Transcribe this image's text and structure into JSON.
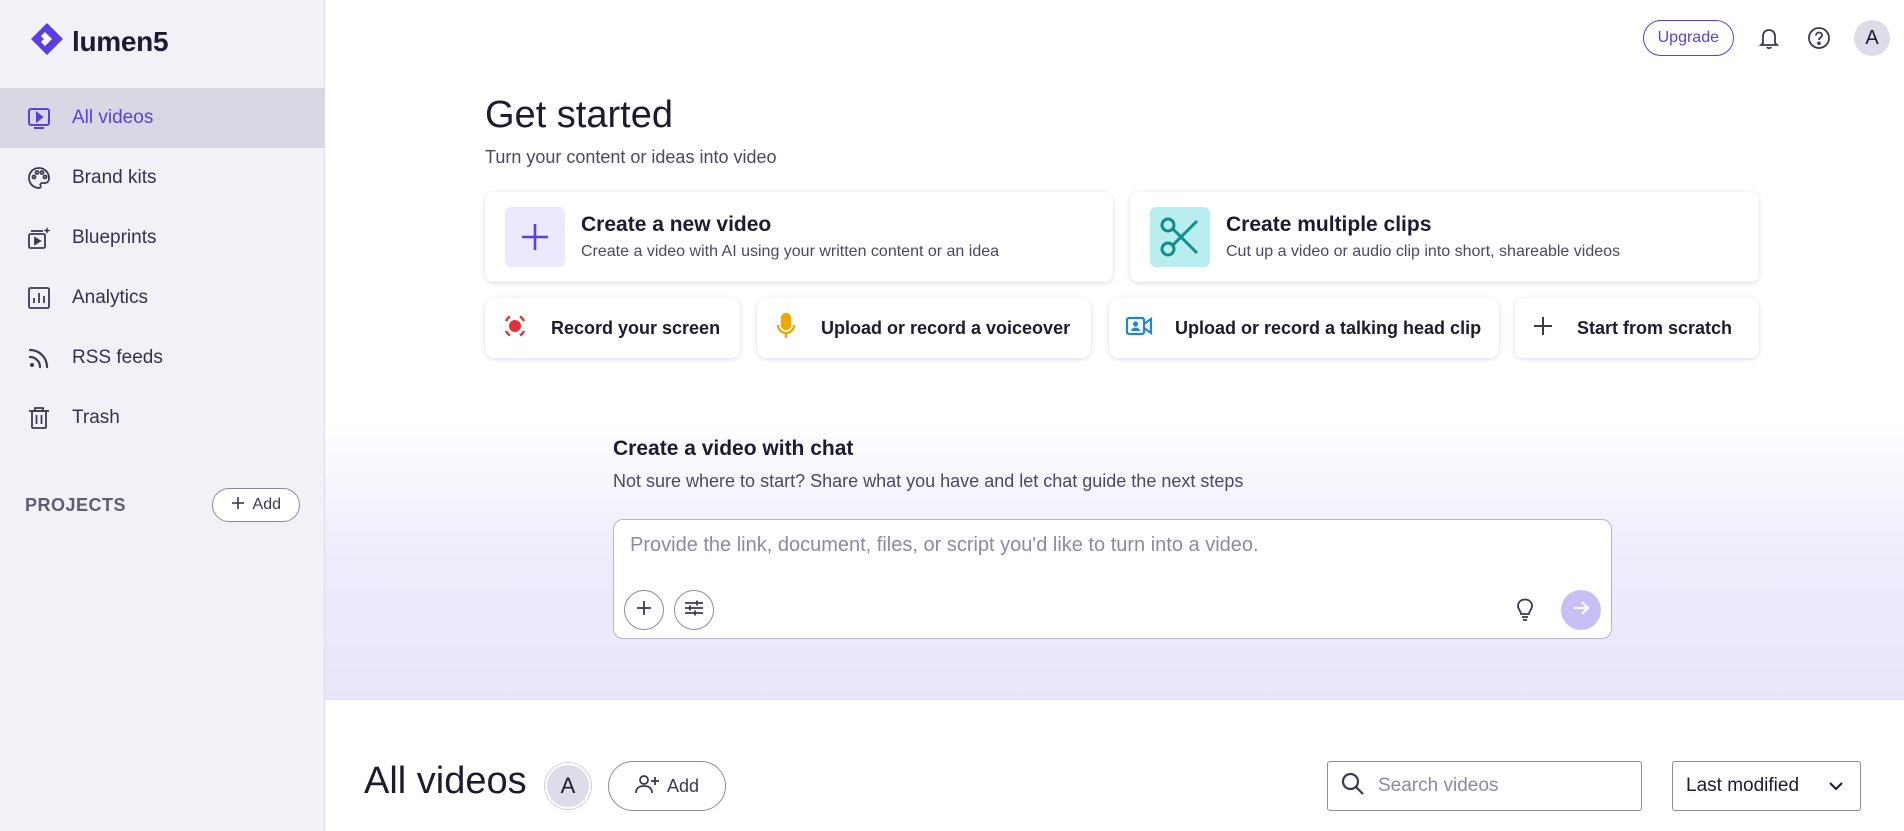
{
  "app": {
    "name": "lumen5",
    "accent_color": "#5b3fe0"
  },
  "sidebar": {
    "items": [
      {
        "label": "All videos",
        "icon": "video-play-icon",
        "active": true
      },
      {
        "label": "Brand kits",
        "icon": "palette-icon",
        "active": false
      },
      {
        "label": "Blueprints",
        "icon": "blueprint-icon",
        "active": false
      },
      {
        "label": "Analytics",
        "icon": "analytics-icon",
        "active": false
      },
      {
        "label": "RSS feeds",
        "icon": "rss-icon",
        "active": false
      },
      {
        "label": "Trash",
        "icon": "trash-icon",
        "active": false
      }
    ],
    "projects_label": "PROJECTS",
    "projects_add_label": "Add"
  },
  "topbar": {
    "upgrade_label": "Upgrade",
    "avatar_initial": "A",
    "icons": [
      "bell-icon",
      "help-icon"
    ]
  },
  "hero": {
    "title": "Get started",
    "subtitle": "Turn your content or ideas into video",
    "big_cards": [
      {
        "title": "Create a new video",
        "desc": "Create a video with AI using your written content or an idea",
        "icon": "plus-icon",
        "icon_color": "#5b3fe0",
        "icon_bg": "#ece8fd"
      },
      {
        "title": "Create multiple clips",
        "desc": "Cut up a video or audio clip into short, shareable videos",
        "icon": "scissors-icon",
        "icon_color": "#0f8f8a",
        "icon_bg": "#b9eef0"
      }
    ],
    "small_cards": [
      {
        "label": "Record your screen",
        "icon": "record-icon",
        "icon_color": "#e0303a"
      },
      {
        "label": "Upload or record a voiceover",
        "icon": "microphone-icon",
        "icon_color": "#f0a800"
      },
      {
        "label": "Upload or record a talking head clip",
        "icon": "video-camera-icon",
        "icon_color": "#1f86d6"
      },
      {
        "label": "Start from scratch",
        "icon": "plus-icon",
        "icon_color": "#3b3a4f"
      }
    ]
  },
  "chat": {
    "title": "Create a video with chat",
    "subtitle": "Not sure where to start? Share what you have and let chat guide the next steps",
    "placeholder": "Provide the link, document, files, or script you'd like to turn into a video."
  },
  "videos": {
    "title": "All videos",
    "avatar_initial": "A",
    "add_label": "Add",
    "search_placeholder": "Search videos",
    "sort_value": "Last modified"
  }
}
